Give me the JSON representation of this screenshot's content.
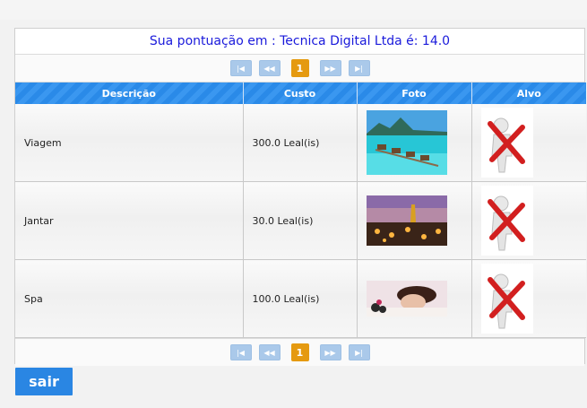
{
  "header": {
    "title": "Sua pontuação em : Tecnica Digital Ltda é: 14.0"
  },
  "pager": {
    "first": "|◀",
    "prev": "◀◀",
    "current": "1",
    "next": "▶▶",
    "last": "▶|"
  },
  "table": {
    "columns": [
      "Descrição",
      "Custo",
      "Foto",
      "Alvo"
    ],
    "rows": [
      {
        "description": "Viagem",
        "cost": "300.0 Leal(is)",
        "photo_icon": "beach-bungalow-photo",
        "target_icon": "no-target-figure-icon"
      },
      {
        "description": "Jantar",
        "cost": "30.0 Leal(is)",
        "photo_icon": "dinner-sunset-photo",
        "target_icon": "no-target-figure-icon"
      },
      {
        "description": "Spa",
        "cost": "100.0 Leal(is)",
        "photo_icon": "spa-massage-photo",
        "target_icon": "no-target-figure-icon"
      }
    ]
  },
  "actions": {
    "exit_label": "sair"
  },
  "colors": {
    "title": "#1a1adb",
    "header_blue": "#2a8ae8",
    "pager_current": "#e59a10",
    "button_blue": "#2a86e3"
  }
}
